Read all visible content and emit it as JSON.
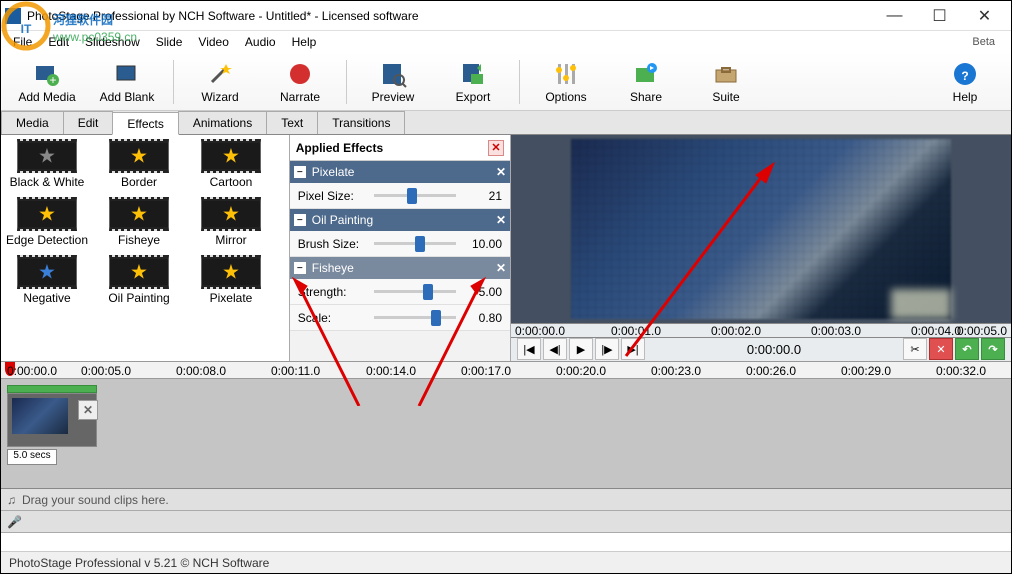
{
  "window": {
    "title": "PhotoStage Professional by NCH Software - Untitled* - Licensed software",
    "beta": "Beta"
  },
  "watermark": {
    "line1": "河狸软件园",
    "line2": "www.pc0359.cn"
  },
  "menu": {
    "file": "File",
    "edit": "Edit",
    "slideshow": "Slideshow",
    "slide": "Slide",
    "video": "Video",
    "audio": "Audio",
    "help": "Help"
  },
  "toolbar": {
    "addmedia": "Add Media",
    "addblank": "Add Blank",
    "wizard": "Wizard",
    "narrate": "Narrate",
    "preview": "Preview",
    "export": "Export",
    "options": "Options",
    "share": "Share",
    "suite": "Suite",
    "help": "Help"
  },
  "tabs": {
    "media": "Media",
    "edit": "Edit",
    "effects": "Effects",
    "animations": "Animations",
    "text": "Text",
    "transitions": "Transitions"
  },
  "effects_grid": {
    "r1c1": "Black & White",
    "r1c2": "Border",
    "r1c3": "Cartoon",
    "r2c1": "Edge Detection",
    "r2c2": "Fisheye",
    "r2c3": "Mirror",
    "r3c1": "Negative",
    "r3c2": "Oil Painting",
    "r3c3": "Pixelate"
  },
  "applied": {
    "title": "Applied Effects",
    "pixelate": {
      "name": "Pixelate",
      "param": "Pixel Size:",
      "value": "21"
    },
    "oil": {
      "name": "Oil Painting",
      "param": "Brush Size:",
      "value": "10.00"
    },
    "fisheye": {
      "name": "Fisheye",
      "param1": "Strength:",
      "value1": "5.00",
      "param2": "Scale:",
      "value2": "0.80"
    }
  },
  "preview_ruler": {
    "t0": "0:00:00.0",
    "t1": "0:00:01.0",
    "t2": "0:00:02.0",
    "t3": "0:00:03.0",
    "t4": "0:00:04.0",
    "t5": "0:00:05.0"
  },
  "preview_controls": {
    "time": "0:00:00.0"
  },
  "timeline_ruler": {
    "t0": "0:00:00.0",
    "t1": "0:00:05.0",
    "t2": "0:00:08.0",
    "t3": "0:00:11.0",
    "t4": "0:00:14.0",
    "t5": "0:00:17.0",
    "t6": "0:00:20.0",
    "t7": "0:00:23.0",
    "t8": "0:00:26.0",
    "t9": "0:00:29.0",
    "t10": "0:00:32.0"
  },
  "clip": {
    "duration": "5.0 secs"
  },
  "audio_hint": "Drag your sound clips here.",
  "status": "PhotoStage Professional v 5.21  © NCH Software"
}
